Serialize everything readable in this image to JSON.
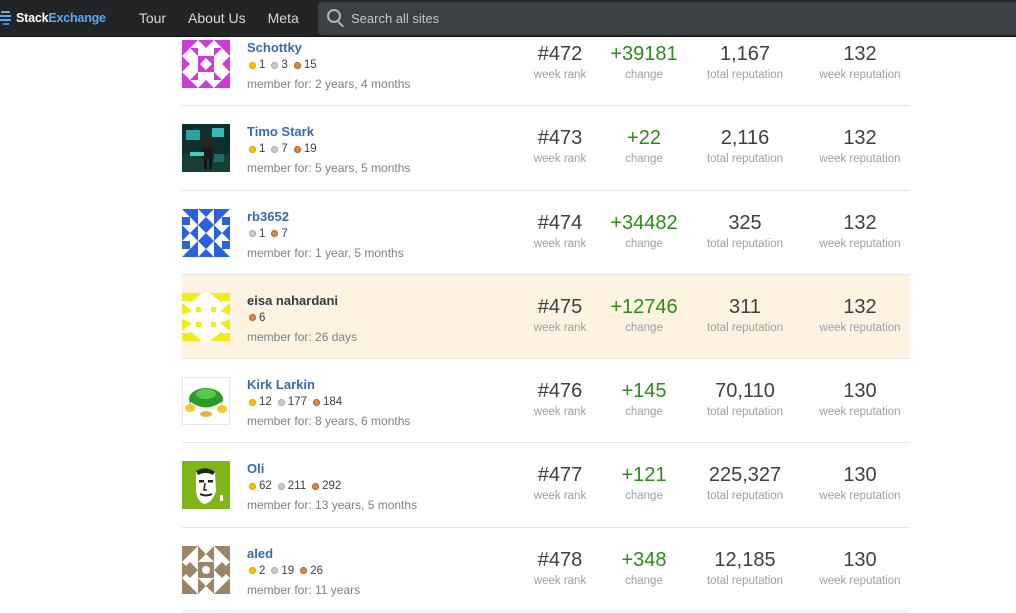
{
  "header": {
    "logo_part1": "Stack",
    "logo_part2": "Exchange",
    "nav": [
      "Tour",
      "About Us",
      "Meta"
    ],
    "search_placeholder": "Search all sites"
  },
  "labels": {
    "week_rank": "week rank",
    "change": "change",
    "total_reputation": "total reputation",
    "week_reputation": "week reputation"
  },
  "users": [
    {
      "name": "Schottky",
      "badges": [
        {
          "type": "gold",
          "count": "1"
        },
        {
          "type": "silver",
          "count": "3"
        },
        {
          "type": "bronze",
          "count": "15"
        }
      ],
      "member": "member for: 2 years, 4 months",
      "rank": "#472",
      "change": "+39181",
      "total": "1,167",
      "week": "132",
      "avatar": "identicon-magenta",
      "highlight": false
    },
    {
      "name": "Timo Stark",
      "badges": [
        {
          "type": "gold",
          "count": "1"
        },
        {
          "type": "silver",
          "count": "7"
        },
        {
          "type": "bronze",
          "count": "19"
        }
      ],
      "member": "member for: 5 years, 5 months",
      "rank": "#473",
      "change": "+22",
      "total": "2,116",
      "week": "132",
      "avatar": "photo-dark-teal",
      "highlight": false
    },
    {
      "name": "rb3652",
      "badges": [
        {
          "type": "silver",
          "count": "1"
        },
        {
          "type": "bronze",
          "count": "7"
        }
      ],
      "member": "member for: 1 year, 5 months",
      "rank": "#474",
      "change": "+34482",
      "total": "325",
      "week": "132",
      "avatar": "identicon-blue",
      "highlight": false
    },
    {
      "name": "eisa nahardani",
      "badges": [
        {
          "type": "bronze",
          "count": "6"
        }
      ],
      "member": "member for: 26 days",
      "rank": "#475",
      "change": "+12746",
      "total": "311",
      "week": "132",
      "avatar": "identicon-yellow",
      "highlight": true
    },
    {
      "name": "Kirk Larkin",
      "badges": [
        {
          "type": "gold",
          "count": "12"
        },
        {
          "type": "silver",
          "count": "177"
        },
        {
          "type": "bronze",
          "count": "184"
        }
      ],
      "member": "member for: 8 years, 6 months",
      "rank": "#476",
      "change": "+145",
      "total": "70,110",
      "week": "130",
      "avatar": "green-shell",
      "highlight": false
    },
    {
      "name": "Oli",
      "badges": [
        {
          "type": "gold",
          "count": "62"
        },
        {
          "type": "silver",
          "count": "211"
        },
        {
          "type": "bronze",
          "count": "292"
        }
      ],
      "member": "member for: 13 years, 5 months",
      "rank": "#477",
      "change": "+121",
      "total": "225,327",
      "week": "130",
      "avatar": "green-face",
      "highlight": false
    },
    {
      "name": "aled",
      "badges": [
        {
          "type": "gold",
          "count": "2"
        },
        {
          "type": "silver",
          "count": "19"
        },
        {
          "type": "bronze",
          "count": "26"
        }
      ],
      "member": "member for: 11 years",
      "rank": "#478",
      "change": "+348",
      "total": "12,185",
      "week": "130",
      "avatar": "identicon-taupe",
      "highlight": false
    }
  ]
}
